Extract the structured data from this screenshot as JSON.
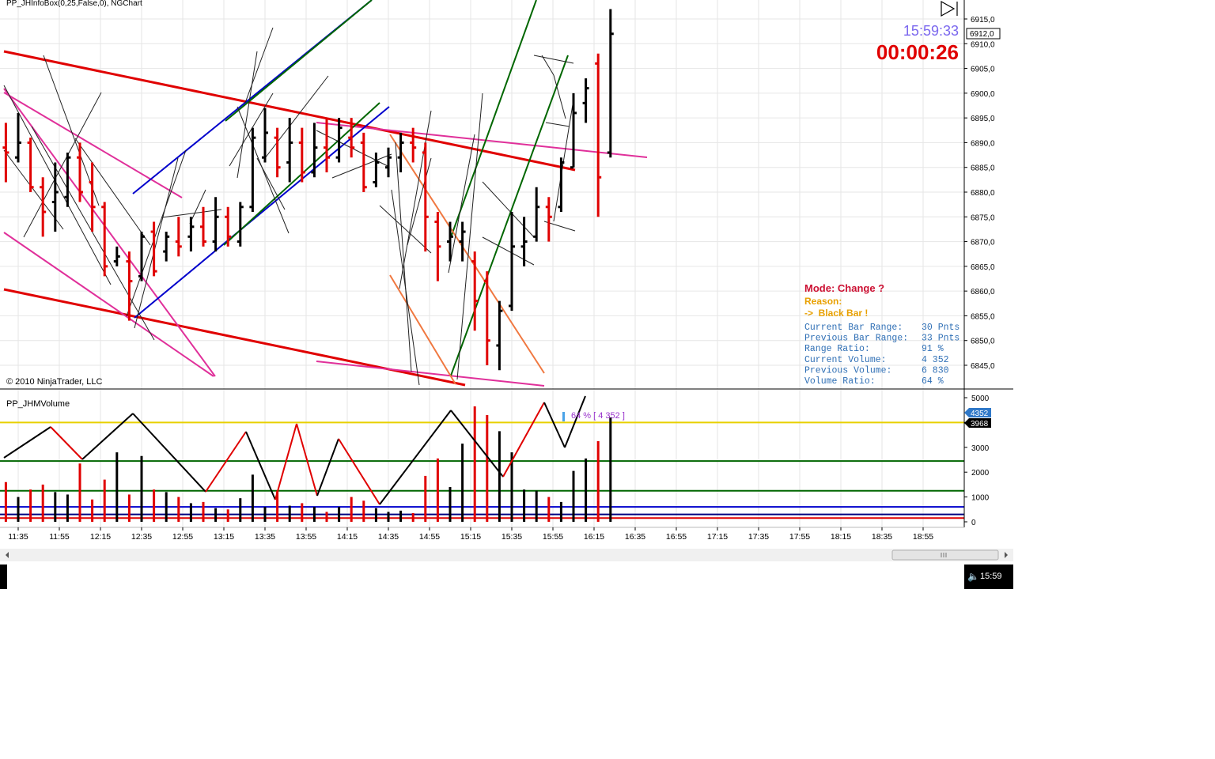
{
  "window": {
    "title": "PP_JHInfoBox(0,25,False,0), NGChart"
  },
  "copyright": "© 2010 NinjaTrader, LLC",
  "clock": {
    "time": "15:59:33",
    "countdown": "00:00:26"
  },
  "price_marker": "6912,0",
  "info_box": {
    "mode": "Mode: Change ?",
    "reason": "Reason:",
    "reason_value": "->  Black Bar !",
    "rows": [
      {
        "label": "Current Bar Range:",
        "value": "30 Pnts"
      },
      {
        "label": "Previous Bar Range:",
        "value": "33 Pnts"
      },
      {
        "label": "Range Ratio:",
        "value": "91 %"
      },
      {
        "label": "Current Volume:",
        "value": "4 352"
      },
      {
        "label": "Previous Volume:",
        "value": "6 830"
      },
      {
        "label": "Volume Ratio:",
        "value": "64 %"
      }
    ],
    "colors": {
      "mode": "#cc1133",
      "reason": "#e8a000",
      "rows": "#2f6fb5"
    }
  },
  "volume_panel": {
    "title": "PP_JHMVolume",
    "annotation": "64 % [ 4 352 ]",
    "current_label": "4352",
    "avg_label": "3968"
  },
  "taskbar": {
    "clock": "15:59",
    "speaker_icon": "speaker-icon"
  },
  "colors": {
    "up": "#000000",
    "down": "#e00000",
    "trend_red": "#e00000",
    "pink": "#e0309a",
    "blue": "#0000cc",
    "green": "#006600",
    "orange": "#f07840",
    "yellow": "#e8d000"
  },
  "chart_data": [
    {
      "type": "ohlc",
      "title": "PP_JHInfoBox(0,25,False,0), NGChart",
      "ylim": [
        6840,
        6917
      ],
      "yticks": [
        "6915,0",
        "6910,0",
        "6905,0",
        "6900,0",
        "6895,0",
        "6890,0",
        "6885,0",
        "6880,0",
        "6875,0",
        "6870,0",
        "6865,0",
        "6860,0",
        "6855,0",
        "6850,0",
        "6845,0"
      ],
      "ytick_values": [
        6915,
        6910,
        6905,
        6900,
        6895,
        6890,
        6885,
        6880,
        6875,
        6870,
        6865,
        6860,
        6855,
        6850,
        6845
      ],
      "bars": [
        {
          "t": "11:29",
          "o": 6889,
          "h": 6894,
          "l": 6882,
          "c": 6888
        },
        {
          "t": "11:35",
          "o": 6887,
          "h": 6896,
          "l": 6886,
          "c": 6890
        },
        {
          "t": "11:41",
          "o": 6890,
          "h": 6891,
          "l": 6880,
          "c": 6881
        },
        {
          "t": "11:47",
          "o": 6881,
          "h": 6883,
          "l": 6871,
          "c": 6876
        },
        {
          "t": "11:53",
          "o": 6878,
          "h": 6886,
          "l": 6872,
          "c": 6880
        },
        {
          "t": "11:59",
          "o": 6879,
          "h": 6888,
          "l": 6877,
          "c": 6887
        },
        {
          "t": "12:05",
          "o": 6887,
          "h": 6890,
          "l": 6878,
          "c": 6880
        },
        {
          "t": "12:11",
          "o": 6882,
          "h": 6886,
          "l": 6872,
          "c": 6877
        },
        {
          "t": "12:17",
          "o": 6877,
          "h": 6878,
          "l": 6863,
          "c": 6865
        },
        {
          "t": "12:23",
          "o": 6866,
          "h": 6869,
          "l": 6865,
          "c": 6867
        },
        {
          "t": "12:29",
          "o": 6866,
          "h": 6868,
          "l": 6854,
          "c": 6862
        },
        {
          "t": "12:35",
          "o": 6863,
          "h": 6872,
          "l": 6862,
          "c": 6871
        },
        {
          "t": "12:41",
          "o": 6872,
          "h": 6874,
          "l": 6863,
          "c": 6864
        },
        {
          "t": "12:47",
          "o": 6868,
          "h": 6872,
          "l": 6866,
          "c": 6871
        },
        {
          "t": "12:53",
          "o": 6870,
          "h": 6875,
          "l": 6867,
          "c": 6869
        },
        {
          "t": "12:59",
          "o": 6871,
          "h": 6875,
          "l": 6868,
          "c": 6873
        },
        {
          "t": "13:05",
          "o": 6873,
          "h": 6877,
          "l": 6869,
          "c": 6870
        },
        {
          "t": "13:11",
          "o": 6870,
          "h": 6879,
          "l": 6868,
          "c": 6875
        },
        {
          "t": "13:17",
          "o": 6875,
          "h": 6877,
          "l": 6869,
          "c": 6871
        },
        {
          "t": "13:23",
          "o": 6870,
          "h": 6878,
          "l": 6869,
          "c": 6877
        },
        {
          "t": "13:29",
          "o": 6877,
          "h": 6893,
          "l": 6876,
          "c": 6891
        },
        {
          "t": "13:35",
          "o": 6887,
          "h": 6897,
          "l": 6886,
          "c": 6892
        },
        {
          "t": "13:41",
          "o": 6891,
          "h": 6893,
          "l": 6883,
          "c": 6885
        },
        {
          "t": "13:47",
          "o": 6886,
          "h": 6895,
          "l": 6882,
          "c": 6890
        },
        {
          "t": "13:53",
          "o": 6890,
          "h": 6893,
          "l": 6882,
          "c": 6884
        },
        {
          "t": "13:59",
          "o": 6884,
          "h": 6894,
          "l": 6883,
          "c": 6889
        },
        {
          "t": "14:05",
          "o": 6889,
          "h": 6895,
          "l": 6884,
          "c": 6887
        },
        {
          "t": "14:11",
          "o": 6887,
          "h": 6895,
          "l": 6886,
          "c": 6893
        },
        {
          "t": "14:17",
          "o": 6891,
          "h": 6895,
          "l": 6887,
          "c": 6889
        },
        {
          "t": "14:23",
          "o": 6890,
          "h": 6892,
          "l": 6880,
          "c": 6881
        },
        {
          "t": "14:29",
          "o": 6882,
          "h": 6888,
          "l": 6881,
          "c": 6886
        },
        {
          "t": "14:35",
          "o": 6885,
          "h": 6889,
          "l": 6883,
          "c": 6887
        },
        {
          "t": "14:41",
          "o": 6887,
          "h": 6892,
          "l": 6884,
          "c": 6890
        },
        {
          "t": "14:47",
          "o": 6890,
          "h": 6893,
          "l": 6886,
          "c": 6889
        },
        {
          "t": "14:53",
          "o": 6888,
          "h": 6890,
          "l": 6868,
          "c": 6875
        },
        {
          "t": "14:59",
          "o": 6874,
          "h": 6876,
          "l": 6862,
          "c": 6869
        },
        {
          "t": "15:05",
          "o": 6870,
          "h": 6874,
          "l": 6866,
          "c": 6871
        },
        {
          "t": "15:11",
          "o": 6870,
          "h": 6874,
          "l": 6866,
          "c": 6872
        },
        {
          "t": "15:17",
          "o": 6866,
          "h": 6868,
          "l": 6852,
          "c": 6858
        },
        {
          "t": "15:23",
          "o": 6862,
          "h": 6864,
          "l": 6845,
          "c": 6850
        },
        {
          "t": "15:29",
          "o": 6849,
          "h": 6858,
          "l": 6844,
          "c": 6856
        },
        {
          "t": "15:35",
          "o": 6857,
          "h": 6876,
          "l": 6856,
          "c": 6869
        },
        {
          "t": "15:41",
          "o": 6869,
          "h": 6875,
          "l": 6865,
          "c": 6870
        },
        {
          "t": "15:47",
          "o": 6871,
          "h": 6881,
          "l": 6870,
          "c": 6877
        },
        {
          "t": "15:53",
          "o": 6877,
          "h": 6879,
          "l": 6870,
          "c": 6875
        },
        {
          "t": "15:59",
          "o": 6877,
          "h": 6887,
          "l": 6876,
          "c": 6886
        },
        {
          "t": "16:05",
          "o": 6885,
          "h": 6900,
          "l": 6885,
          "c": 6896
        },
        {
          "t": "16:11",
          "o": 6898,
          "h": 6903,
          "l": 6894,
          "c": 6901
        },
        {
          "t": "16:17",
          "o": 6906,
          "h": 6908,
          "l": 6875,
          "c": 6883
        },
        {
          "t": "16:23",
          "o": 6888,
          "h": 6917,
          "l": 6887,
          "c": 6912
        }
      ]
    },
    {
      "type": "bar",
      "title": "PP_JHMVolume",
      "ylim": [
        0,
        5000
      ],
      "yticks": [
        "5000",
        "4000",
        "3000",
        "2000",
        "1000",
        "0"
      ],
      "ytick_values": [
        5000,
        4000,
        3000,
        2000,
        1000,
        0
      ],
      "xticks": [
        "11:35",
        "11:55",
        "12:15",
        "12:35",
        "12:55",
        "13:15",
        "13:35",
        "13:55",
        "14:15",
        "14:35",
        "14:55",
        "15:15",
        "15:35",
        "15:55",
        "16:15",
        "16:35",
        "16:55",
        "17:15",
        "17:35",
        "17:55",
        "18:15",
        "18:35",
        "18:55"
      ],
      "volumes": [
        1600,
        1000,
        1300,
        1500,
        1200,
        1100,
        2350,
        900,
        1700,
        2800,
        1100,
        2650,
        1300,
        1200,
        1000,
        750,
        800,
        550,
        500,
        950,
        1900,
        600,
        1250,
        650,
        750,
        600,
        400,
        600,
        1000,
        850,
        550,
        400,
        450,
        350,
        1850,
        2550,
        1400,
        3150,
        4650,
        4300,
        3650,
        2800,
        1300,
        1250,
        1000,
        800,
        2050,
        2550,
        3250,
        4200,
        4352
      ],
      "reference_lines": [
        {
          "name": "yellow",
          "value": 4000,
          "color": "#e8d000"
        },
        {
          "name": "green-upper",
          "value": 2450,
          "color": "#006600"
        },
        {
          "name": "green-lower",
          "value": 1250,
          "color": "#006600"
        },
        {
          "name": "blue",
          "value": 600,
          "color": "#0000cc"
        },
        {
          "name": "dark-blue",
          "value": 300,
          "color": "#000080"
        },
        {
          "name": "red",
          "value": 150,
          "color": "#e00000"
        }
      ]
    }
  ]
}
